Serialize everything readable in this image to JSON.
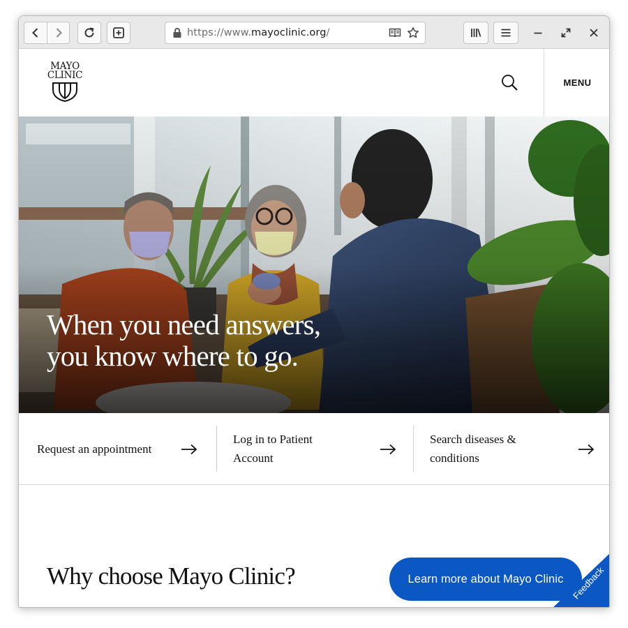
{
  "browser": {
    "url_prefix": "https://www.",
    "url_host": "mayoclinic.org",
    "url_suffix": "/"
  },
  "header": {
    "logo_line1": "MAYO",
    "logo_line2": "CLINIC",
    "menu_label": "MENU"
  },
  "hero": {
    "headline_line1": "When you need answers,",
    "headline_line2": "you know where to go."
  },
  "quick_links": [
    {
      "line1": "Request an appointment",
      "line2": ""
    },
    {
      "line1": "Log in to Patient",
      "line2": "Account"
    },
    {
      "line1": "Search diseases &",
      "line2": "conditions"
    }
  ],
  "why": {
    "heading": "Why choose Mayo Clinic?",
    "cta_label": "Learn more about Mayo Clinic"
  },
  "feedback": {
    "label": "Feedback"
  },
  "colors": {
    "accent": "#0b57c4",
    "toolbar": "#e9e9e9"
  }
}
